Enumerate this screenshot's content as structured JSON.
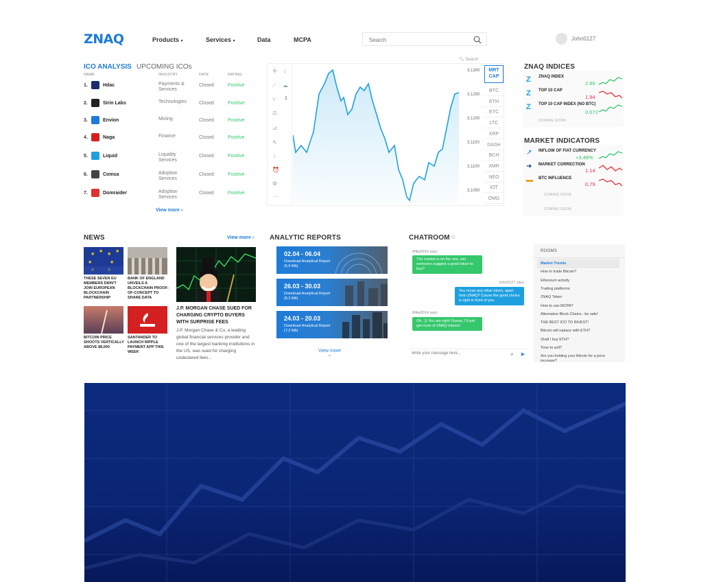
{
  "header": {
    "logo": "ZNAQ",
    "nav": [
      {
        "label": "Products",
        "has_menu": true
      },
      {
        "label": "Services",
        "has_menu": true
      },
      {
        "label": "Data",
        "has_menu": false
      },
      {
        "label": "MCPA",
        "has_menu": false
      }
    ],
    "search_placeholder": "Search",
    "username": "John0127"
  },
  "ico": {
    "tab_active": "ICO ANALYSIS",
    "tab_other": "UPCOMING ICOs",
    "columns": [
      "NAME",
      "INDUSTRY",
      "DATE",
      "RATING"
    ],
    "rows": [
      {
        "num": "1.",
        "name": "Hdac",
        "industry": "Payments & Services",
        "date": "Closed",
        "rating": "Positive",
        "color": "#1a2f6b"
      },
      {
        "num": "2.",
        "name": "Sirin Labs",
        "industry": "Technologies",
        "date": "Closed",
        "rating": "Positive",
        "color": "#222222"
      },
      {
        "num": "3.",
        "name": "Envion",
        "industry": "Mining",
        "date": "Closed",
        "rating": "Positive",
        "color": "#1e7bd8"
      },
      {
        "num": "4.",
        "name": "Naga",
        "industry": "Finance",
        "date": "Closed",
        "rating": "Positive",
        "color": "#d42020"
      },
      {
        "num": "5.",
        "name": "Liquid",
        "industry": "Liquidity Services",
        "date": "Closed",
        "rating": "Positive",
        "color": "#1ea0e0"
      },
      {
        "num": "6.",
        "name": "Comsa",
        "industry": "Adoption Services",
        "date": "Closed",
        "rating": "Positive",
        "color": "#444444"
      },
      {
        "num": "7.",
        "name": "Domraider",
        "industry": "Adoption Services",
        "date": "Closed",
        "rating": "Positive",
        "color": "#e03030"
      }
    ],
    "view_more": "View more ›"
  },
  "market_chart": {
    "search_label": "Search",
    "scale_labels": [
      "3,1300",
      "3,1250",
      "3,1200",
      "3,1150",
      "3,1100",
      "3,1050"
    ],
    "coins": [
      "MRT CAP",
      "BTC",
      "ETH",
      "ETC",
      "LTC",
      "XRP",
      "DASH",
      "BCH",
      "XMR",
      "NEO",
      "IOT",
      "OMG"
    ],
    "active_coin": "MRT CAP",
    "zoom_value": "1",
    "tools": [
      "crosshair-icon",
      "line-icon",
      "fork-icon",
      "text-icon",
      "pattern-icon",
      "measure-icon",
      "zoom-icon",
      "eye-icon",
      "lock-icon",
      "settings-icon",
      "more-icon"
    ]
  },
  "znaq_indices": {
    "title": "ZNAQ INDICES",
    "items": [
      {
        "name": "ZNAQ INDEX",
        "value": "2.89",
        "color": "#35c76c",
        "trend": "up"
      },
      {
        "name": "TOP 10 CAP",
        "value": "1.94",
        "color": "#e8323c",
        "trend": "down"
      },
      {
        "name": "TOP 10 CAP INDEX (NO BTC)",
        "value": "0.672",
        "color": "#35c76c",
        "trend": "up"
      }
    ],
    "coming_soon": "COMING SOON"
  },
  "market_indicators": {
    "title": "MARKET INDICATORS",
    "items": [
      {
        "name": "INFLOW OF FIAT CURRENCY",
        "value": "+3,48%",
        "color": "#35c76c",
        "trend": "up"
      },
      {
        "name": "MARKET CORRECTION",
        "value": "1.14",
        "color": "#e8323c",
        "trend": "wave"
      },
      {
        "name": "BTC INFLUENCE",
        "value": "0,79",
        "color": "#e8323c",
        "trend": "down"
      }
    ],
    "coming_soon": [
      "COMING SOON",
      "COMING SOON"
    ]
  },
  "news": {
    "title": "NEWS",
    "view_more": "View more ›",
    "items": [
      {
        "caption": "THESE SEVEN EU MEMBERS DIDN'T JOIN EUROPEAN BLOCKCHAIN PARTNERSHIP"
      },
      {
        "caption": "BANK OF ENGLAND UNVEILS A BLOCKCHAIN PROOF-OF-CONCEPT TO SHARE DATA"
      },
      {
        "caption": "BITCOIN PRICE SHOOTS VERTICALLY ABOVE $8,000"
      },
      {
        "caption": "SANTANDER TO LAUNCH RIPPLE PAYMENT APP THIS WEEK"
      }
    ],
    "featured": {
      "headline": "J.P. MORGAN CHASE SUED FOR CHARGING CRYPTO BUYERS WITH SURPRISE FEES",
      "body": "J.P. Morgan Chase & Co, a leading global financial services provider and one of the largest banking institutions in the US, was sued for charging undeclared fees..."
    }
  },
  "reports": {
    "title": "ANALYTIC REPORTS",
    "items": [
      {
        "dates": "02.04 - 06.04",
        "label": "Download Analytical Report (5,9 Mb)"
      },
      {
        "dates": "26.03 - 30.03",
        "label": "Download Analytical Report (6,3 Mb)"
      },
      {
        "dates": "24.03 - 20.03",
        "label": "Download Analytical Report (7,2 Mb)"
      }
    ],
    "view_more": "View more"
  },
  "chatroom": {
    "title": "CHATROOM",
    "messages": [
      {
        "author": "Mika0014 says",
        "text": "The market is on the rise, can someone suggest a good token to buy?",
        "side": "left"
      },
      {
        "author": "John0127 says",
        "text": "You mean any other token, apart from ZNAQ? Cause the good choice is right in front of you.",
        "side": "right"
      },
      {
        "author": "Mika0014 says",
        "text": "Oh...)) You are right! Guess, I'll just get more of ZNAQ tokens!",
        "side": "left"
      }
    ],
    "input_placeholder": "Write your message here..."
  },
  "rooms": {
    "title": "ROOMS",
    "items": [
      "Market Trends",
      "How to trade Bitcoin?",
      "Ethereum activity",
      "Trading platforms",
      "ZNAQ Token",
      "How to use MCPA?",
      "Alternative Block Chains : be safe!",
      "THE BEST ICO TO INVEST!",
      "Bitcoin will replace with ETH?",
      "Shall I buy ETH?",
      "Time to sell?",
      "Are you holding your Altcoin for a price increase?"
    ],
    "active": "Market Trends"
  }
}
